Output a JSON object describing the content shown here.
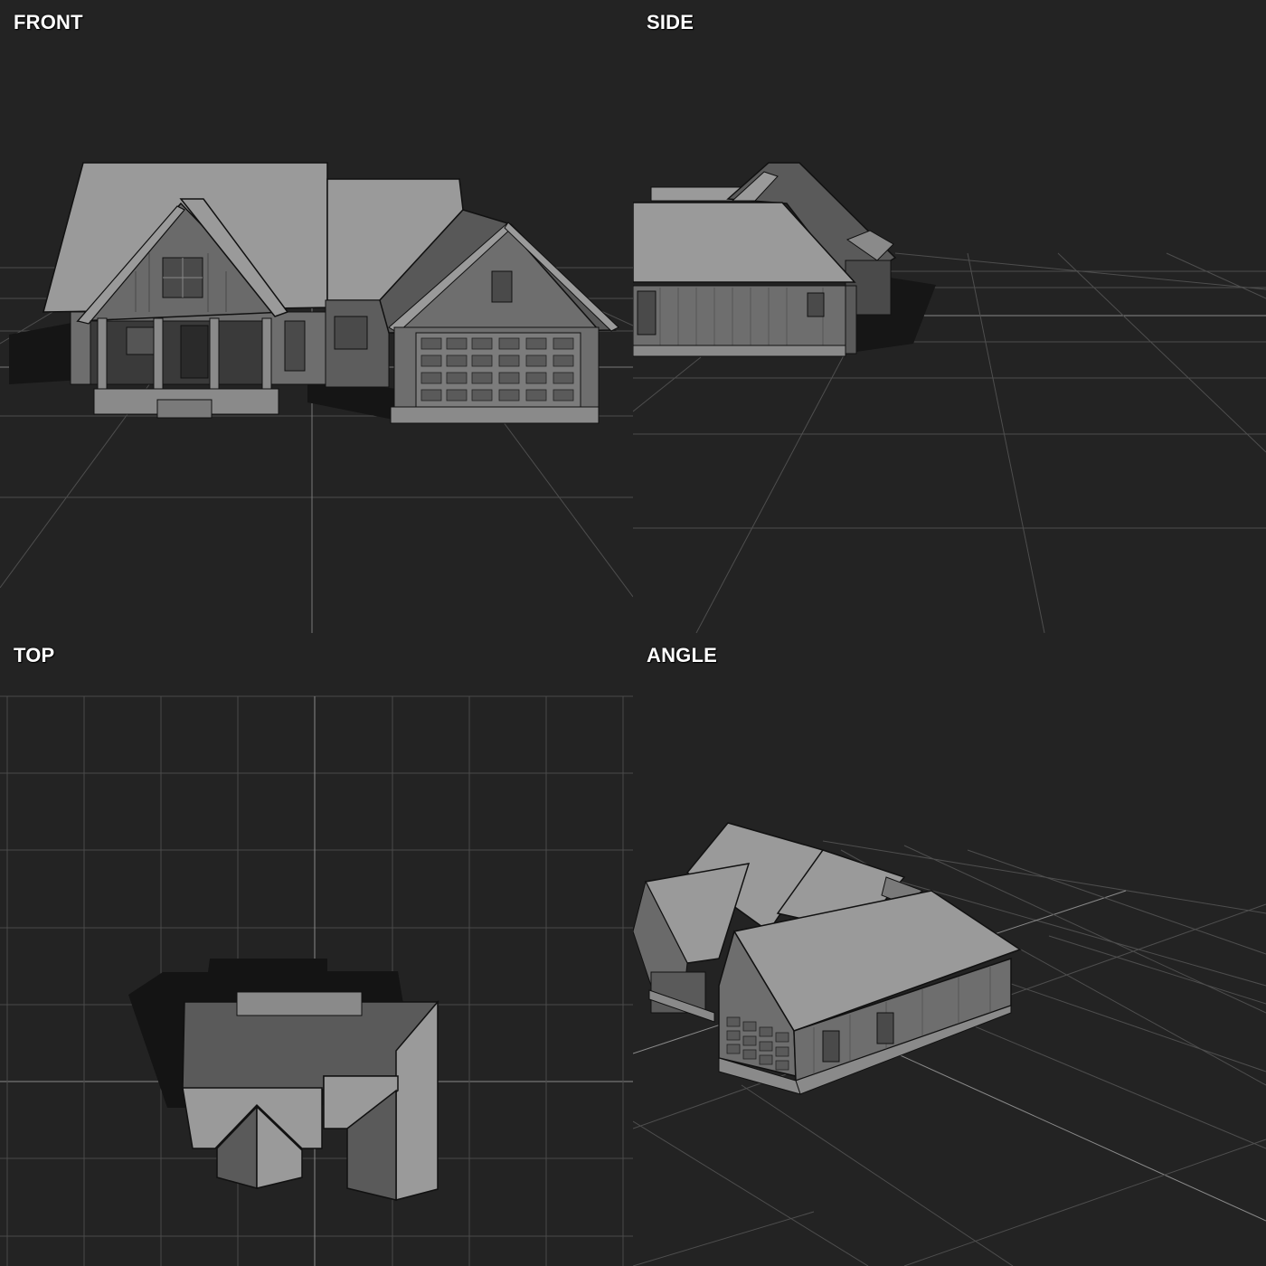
{
  "viewports": {
    "front": {
      "label": "FRONT"
    },
    "side": {
      "label": "SIDE"
    },
    "top": {
      "label": "TOP"
    },
    "angle": {
      "label": "ANGLE"
    }
  },
  "colors": {
    "background": "#232323",
    "grid": "#555555",
    "grid_axis": "#8a8a8a",
    "roof_light": "#9a9a9a",
    "roof_dark": "#5a5a5a",
    "wall": "#7a7a7a",
    "wall_dark": "#555555",
    "shadow": "#161616",
    "edge": "#111111"
  },
  "icons": {
    "model": "house-model-icon"
  }
}
